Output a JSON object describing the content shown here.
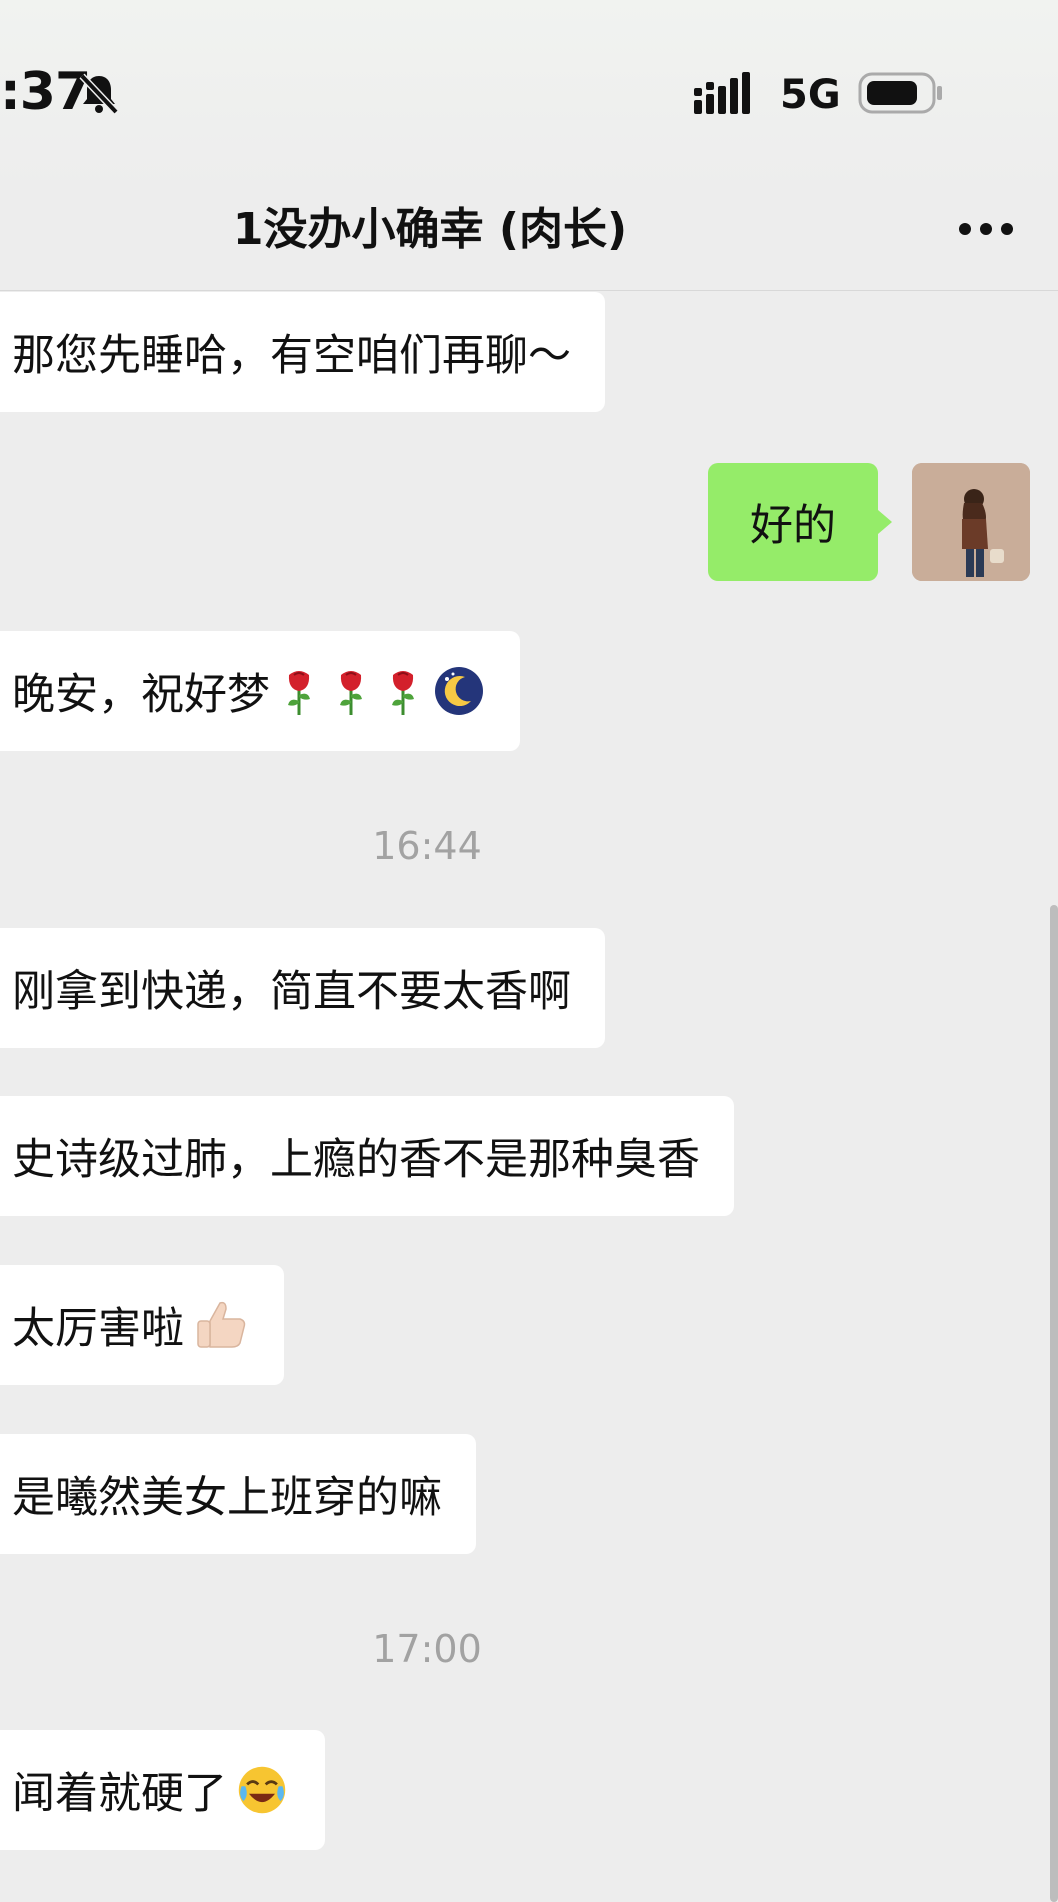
{
  "status": {
    "time": ":37",
    "network": "5G"
  },
  "chat": {
    "title": "1没办小确幸 (肉长)"
  },
  "messages": [
    {
      "side": "left",
      "text": "那您先睡哈，有空咱们再聊～"
    },
    {
      "side": "right",
      "text": "好的"
    },
    {
      "side": "left",
      "text": "晚安，祝好梦"
    },
    {
      "type": "time",
      "text": "16:44"
    },
    {
      "side": "left",
      "text": "刚拿到快递，简直不要太香啊"
    },
    {
      "side": "left",
      "text": "史诗级过肺，上瘾的香不是那种臭香"
    },
    {
      "side": "left",
      "text": "太厉害啦"
    },
    {
      "side": "left",
      "text": "是曦然美女上班穿的嘛"
    },
    {
      "type": "time",
      "text": "17:00"
    },
    {
      "side": "left",
      "text": "闻着就硬了"
    }
  ],
  "icons": {
    "bell": "bell-muted-icon",
    "signal": "signal-icon",
    "battery": "battery-icon",
    "more": "more-icon",
    "rose": "rose-emoji",
    "moon": "moon-emoji",
    "thumb": "thumbs-up-emoji",
    "laugh": "laughing-crying-emoji"
  },
  "colors": {
    "background": "#ededed",
    "bubble_self": "#95ec69",
    "bubble_other": "#ffffff"
  }
}
